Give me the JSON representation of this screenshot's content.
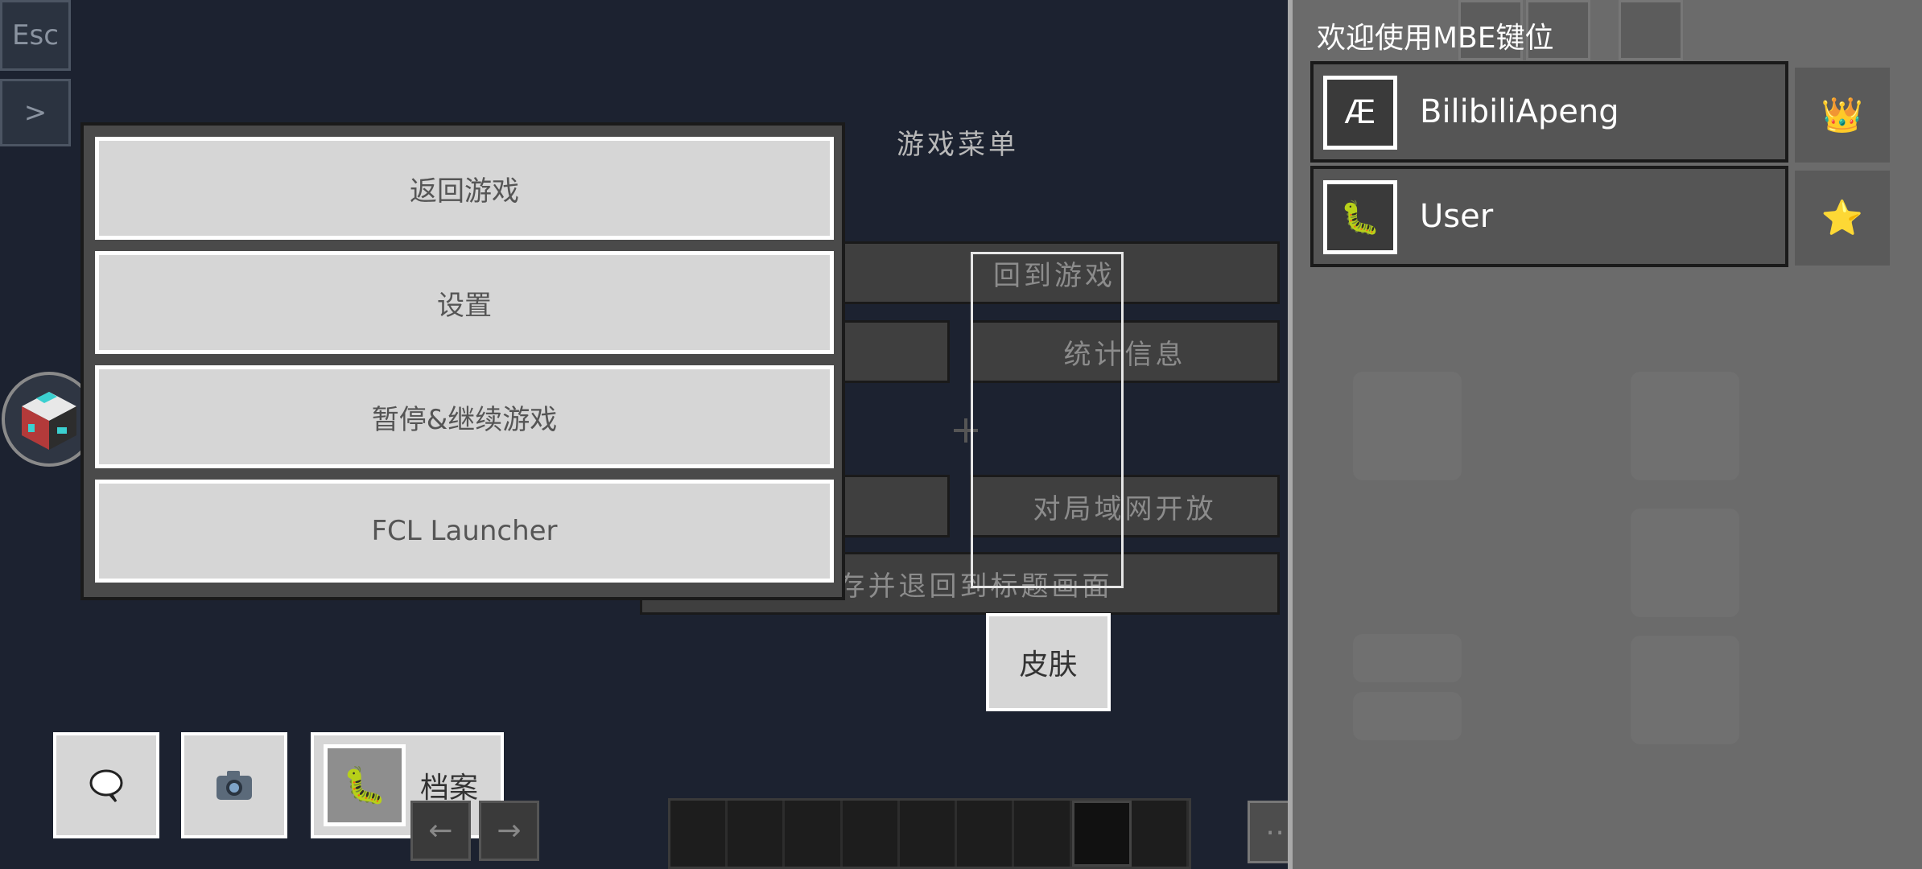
{
  "hud": {
    "esc_label": "Esc",
    "expand_label": ">"
  },
  "background_menu": {
    "title": "游戏菜单",
    "back_to_game": "回到游戏",
    "statistics": "统计信息",
    "open_to_lan": "对局域网开放",
    "save_and_quit": "保存并退回到标题画面"
  },
  "popup_menu": {
    "items": [
      {
        "label": "返回游戏"
      },
      {
        "label": "设置"
      },
      {
        "label": "暂停&继续游戏"
      },
      {
        "label": "FCL Launcher"
      }
    ]
  },
  "bottom_bar": {
    "chat_icon": "speech-bubble-icon",
    "camera_icon": "camera-icon",
    "profile_label": "档案",
    "skin_label": "皮肤"
  },
  "right_panel": {
    "title": "欢迎使用MBE键位",
    "users": [
      {
        "name": "BilibiliApeng",
        "avatar": "Æ",
        "badge": "👑"
      },
      {
        "name": "User",
        "avatar": "🐛",
        "badge": "⭐"
      }
    ]
  },
  "colors": {
    "background": "#1c2230",
    "menu_button": "#d6d6d6",
    "panel": "#6b6b6b"
  }
}
